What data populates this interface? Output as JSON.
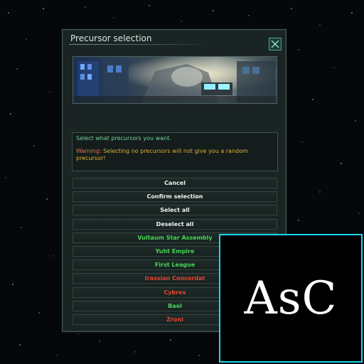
{
  "dialog": {
    "title": "Precursor selection",
    "close_icon": "close-x-icon",
    "banner_image": "spaceship-interior-bridge",
    "info_text": "Select what precursors you want.",
    "warning_label": "Warning:",
    "warning_text": " Selecting no precursors will not give you a random precursor!",
    "buttons": [
      {
        "label": "Cancel",
        "color": "#eef3f2"
      },
      {
        "label": "Confirm selection",
        "color": "#eef3f2"
      },
      {
        "label": "Select all",
        "color": "#eef3f2"
      },
      {
        "label": "Deselect all",
        "color": "#eef3f2"
      },
      {
        "label": "Vultaum Star Assembly",
        "color": "#45d656"
      },
      {
        "label": "Yuht Empire",
        "color": "#45d656"
      },
      {
        "label": "First League",
        "color": "#45d656"
      },
      {
        "label": "Irassian Concordat",
        "color": "#e7442f"
      },
      {
        "label": "Cybrex",
        "color": "#e7442f"
      },
      {
        "label": "Baol",
        "color": "#45d656"
      },
      {
        "label": "Zroni",
        "color": "#e7442f"
      }
    ]
  },
  "overlay": {
    "logo_text": "AsC",
    "border_color": "#1ad8ee"
  }
}
